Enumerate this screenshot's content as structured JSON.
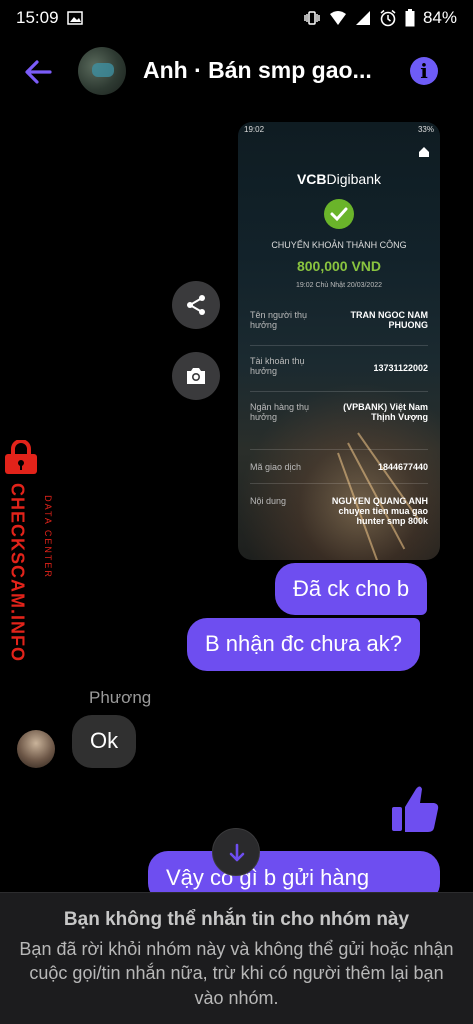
{
  "status_bar": {
    "time": "15:09",
    "battery": "84%",
    "icons": [
      "image-icon",
      "vibrate-icon",
      "wifi-icon",
      "signal-icon",
      "alarm-icon",
      "battery-icon"
    ]
  },
  "header": {
    "title": "Anh · Bán smp gao...",
    "info_icon": "i"
  },
  "transfer_screenshot": {
    "status_time": "19:02",
    "status_battery": "33%",
    "brand_bold": "VCB",
    "brand_rest": "Digibank",
    "headline": "CHUYỂN KHOẢN THÀNH CÔNG",
    "amount": "800,000 VND",
    "datetime": "19:02 Chủ Nhật 20/03/2022",
    "rows": [
      {
        "label": "Tên người thụ hưởng",
        "value": "TRAN NGOC NAM PHUONG"
      },
      {
        "label": "Tài khoản thụ hưởng",
        "value": "13731122002"
      },
      {
        "label": "Ngân hàng thụ hưởng",
        "value": "(VPBANK) Việt Nam Thịnh Vượng"
      },
      {
        "label": "Mã giao dịch",
        "value": "1844677440"
      },
      {
        "label": "Nội dung",
        "value": "NGUYEN QUANG ANH chuyen tien mua gao hunter smp 800k"
      }
    ]
  },
  "watermark": {
    "main": "CHECKSCAM.INFO",
    "sub": "DATA CENTER"
  },
  "messages": {
    "out1": "Đã ck cho b",
    "out2": "B nhận đc chưa ak?",
    "sender_name": "Phương",
    "in1": "Ok",
    "out3": "Vậy có gì b gửi hàng"
  },
  "footer": {
    "heading": "Bạn không thể nhắn tin cho nhóm này",
    "body": "Bạn đã rời khỏi nhóm này và không thể gửi hoặc nhận cuộc gọi/tin nhắn nữa, trừ khi có người thêm lại bạn vào nhóm."
  },
  "colors": {
    "accent": "#6e4ef0",
    "incoming": "#303030",
    "watermark": "#e2231a",
    "success": "#8ac43f"
  }
}
